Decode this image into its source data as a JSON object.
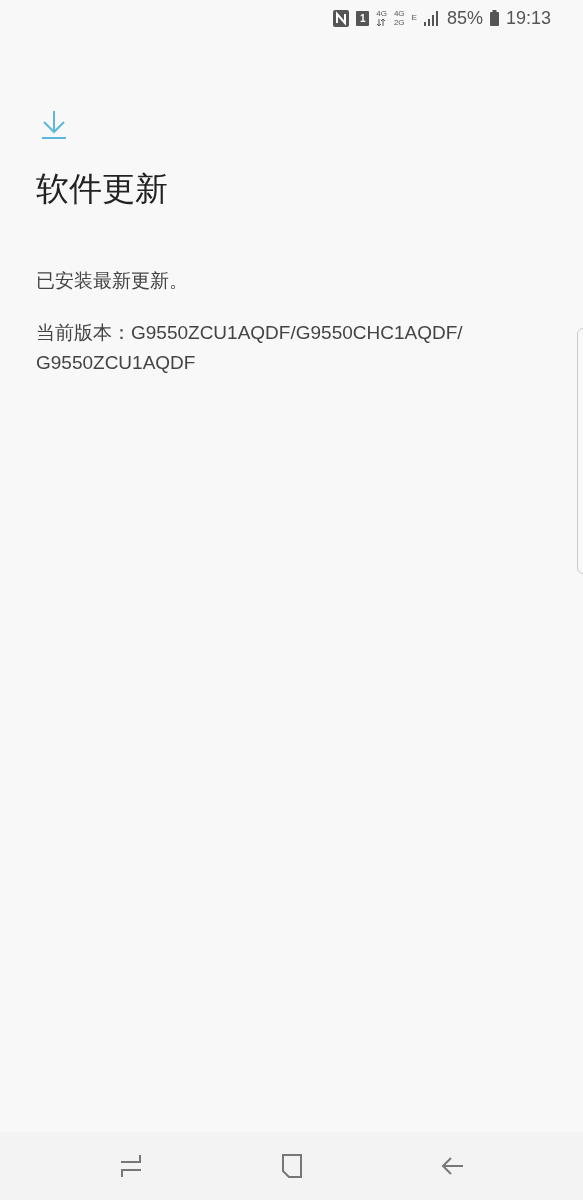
{
  "status_bar": {
    "sim_slot": "1",
    "network_1": "4G",
    "network_2a": "4G",
    "network_2b": "2G",
    "network_3": "E",
    "battery": "85%",
    "time": "19:13"
  },
  "title": "软件更新",
  "message": "已安装最新更新。",
  "version": "当前版本：G9550ZCU1AQDF/G9550CHC1AQDF/\nG9550ZCU1AQDF"
}
